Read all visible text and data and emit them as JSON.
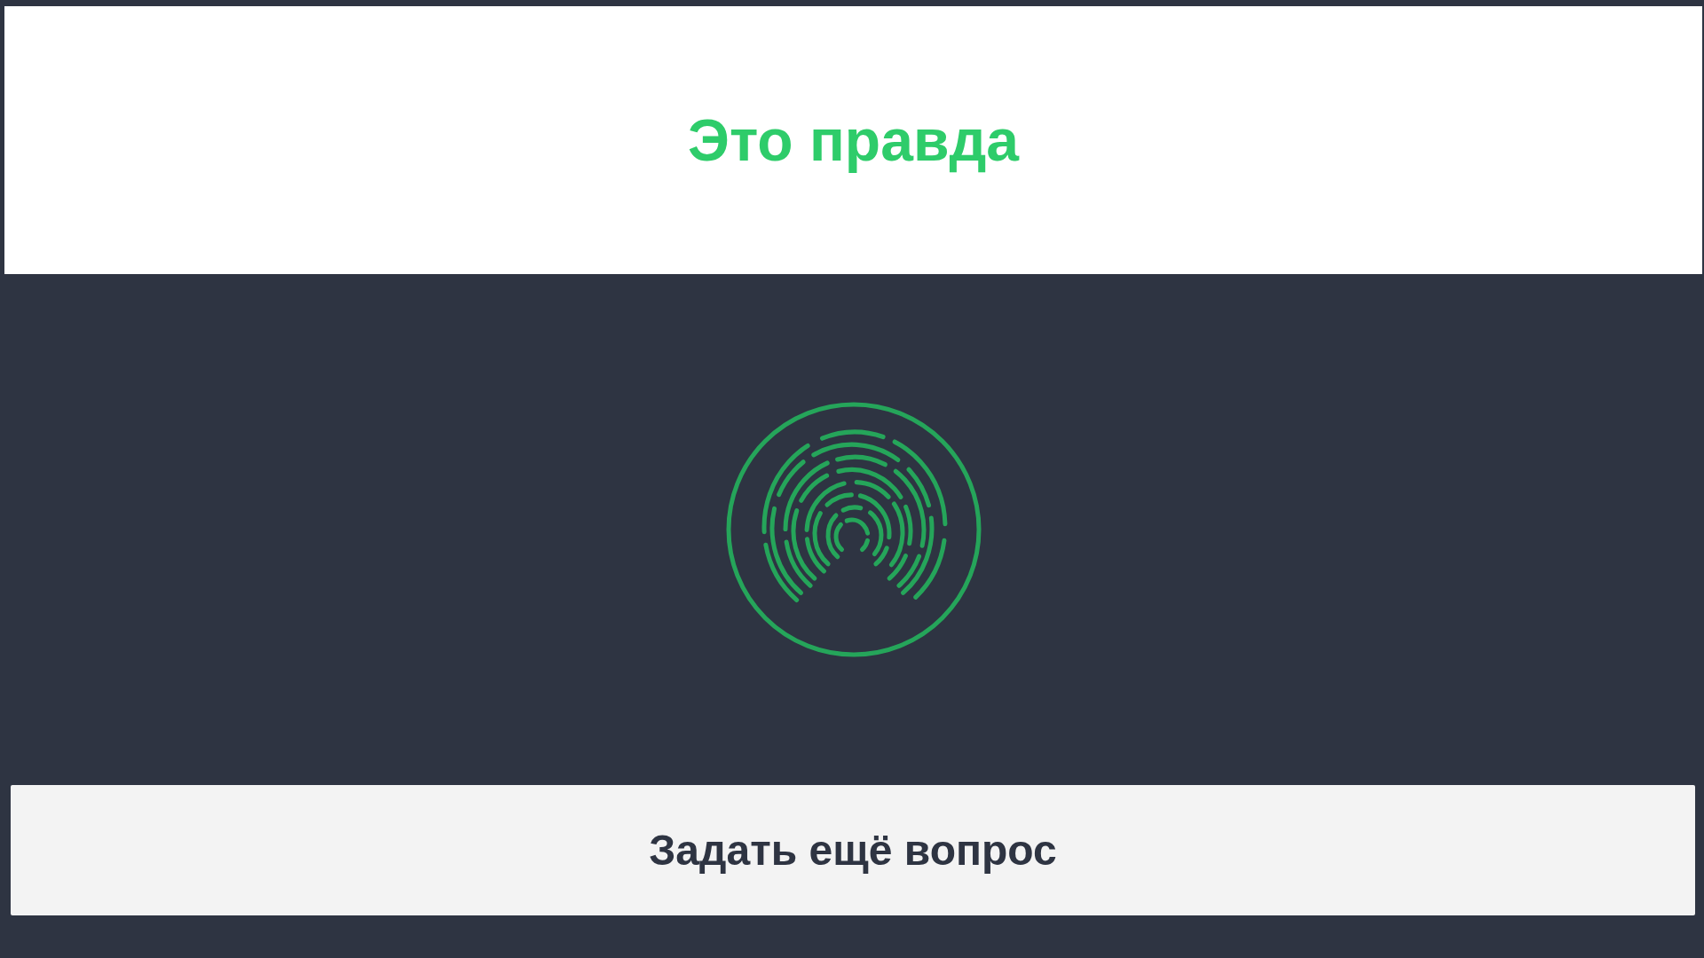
{
  "result": {
    "title": "Это правда"
  },
  "button": {
    "label": "Задать ещё вопрос"
  }
}
